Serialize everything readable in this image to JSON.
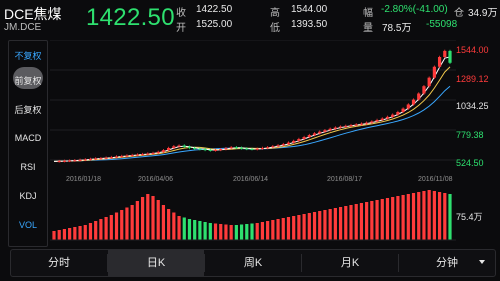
{
  "header": {
    "symbol": "DCE焦煤",
    "code": "JM.DCE",
    "last_price": "1422.50",
    "quote": {
      "close_label": "收",
      "close_value": "1422.50",
      "high_label": "高",
      "high_value": "1544.00",
      "change_label": "幅",
      "change_value": "-2.80%(-41.00)",
      "position_label": "仓",
      "position_value": "34.9万",
      "open_label": "开",
      "open_value": "1525.00",
      "low_label": "低",
      "low_value": "1393.50",
      "volume_label": "量",
      "volume_value": "78.5万",
      "delta_value": "-55098"
    }
  },
  "sidebar": {
    "items": [
      "不复权",
      "前复权",
      "后复权",
      "MACD",
      "RSI",
      "KDJ",
      "VOL"
    ],
    "active_label": "不复权",
    "selected_label": "前复权"
  },
  "price_axis": {
    "labels": [
      "1544.00",
      "1289.12",
      "1034.25",
      "779.38",
      "524.50"
    ]
  },
  "volume_axis": {
    "label": "75.4万"
  },
  "date_axis": [
    "2016/01/18",
    "2016/04/06",
    "2016/06/14",
    "2016/08/17",
    "2016/11/08"
  ],
  "colors": {
    "up": "#ff3b3b",
    "down": "#2ee06f",
    "ma1": "#ffffff",
    "ma2": "#f2c94c",
    "ma3": "#39a7ff",
    "active": "#39a7ff",
    "background": "#0b0b0d"
  },
  "tabs": [
    "分时",
    "日K",
    "周K",
    "月K",
    "分钟"
  ],
  "active_tab": "日K",
  "chart_data": {
    "type": "candlestick",
    "x_range": [
      "2016/01/18",
      "2016/11/28"
    ],
    "ylim": [
      524.5,
      1544.0
    ],
    "close": [
      612,
      614,
      616,
      618,
      621,
      624,
      628,
      632,
      636,
      638,
      642,
      647,
      652,
      656,
      660,
      664,
      668,
      672,
      676,
      681,
      690,
      704,
      722,
      736,
      742,
      732,
      722,
      716,
      712,
      706,
      702,
      706,
      712,
      720,
      728,
      724,
      718,
      714,
      712,
      716,
      722,
      728,
      736,
      744,
      754,
      766,
      780,
      796,
      812,
      828,
      842,
      856,
      868,
      880,
      890,
      898,
      904,
      910,
      916,
      922,
      930,
      940,
      952,
      964,
      978,
      996,
      1018,
      1046,
      1080,
      1120,
      1170,
      1230,
      1300,
      1390,
      1470,
      1520,
      1422.5
    ],
    "volume_ratio": [
      0.18,
      0.2,
      0.22,
      0.24,
      0.26,
      0.28,
      0.3,
      0.34,
      0.38,
      0.42,
      0.46,
      0.5,
      0.55,
      0.6,
      0.65,
      0.7,
      0.78,
      0.86,
      0.92,
      0.88,
      0.8,
      0.7,
      0.62,
      0.55,
      0.48,
      0.45,
      0.42,
      0.4,
      0.38,
      0.36,
      0.34,
      0.33,
      0.32,
      0.31,
      0.3,
      0.3,
      0.31,
      0.32,
      0.33,
      0.34,
      0.36,
      0.38,
      0.4,
      0.42,
      0.44,
      0.46,
      0.48,
      0.5,
      0.52,
      0.54,
      0.56,
      0.58,
      0.6,
      0.62,
      0.64,
      0.66,
      0.68,
      0.7,
      0.72,
      0.74,
      0.76,
      0.78,
      0.8,
      0.82,
      0.84,
      0.86,
      0.88,
      0.9,
      0.92,
      0.94,
      0.96,
      0.98,
      1.0,
      0.98,
      0.96,
      0.94,
      0.92
    ]
  }
}
